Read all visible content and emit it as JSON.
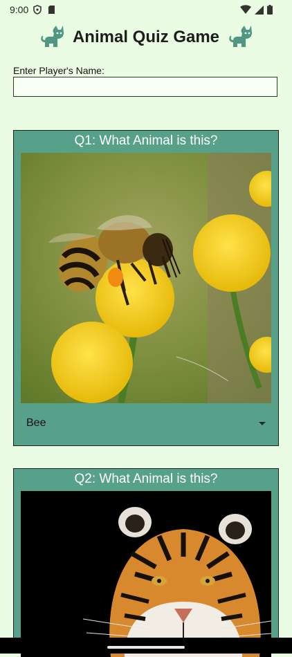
{
  "status_bar": {
    "time": "9:00",
    "icons": [
      "shield-icon",
      "sd-card-icon",
      "wifi-icon",
      "signal-icon",
      "battery-icon"
    ]
  },
  "header": {
    "title": "Animal Quiz Game",
    "icon": "cat-icon",
    "icon_color": "#4f9683"
  },
  "player": {
    "label": "Enter Player's Name:",
    "value": "",
    "placeholder": ""
  },
  "questions": [
    {
      "title": "Q1: What Animal is this?",
      "image": "bee-on-flower",
      "selected_answer": "Bee"
    },
    {
      "title": "Q2: What Animal is this?",
      "image": "tiger-face",
      "selected_answer": ""
    }
  ],
  "colors": {
    "background": "#eafce3",
    "card": "#57a08a",
    "card_border": "#1f1f1f"
  }
}
